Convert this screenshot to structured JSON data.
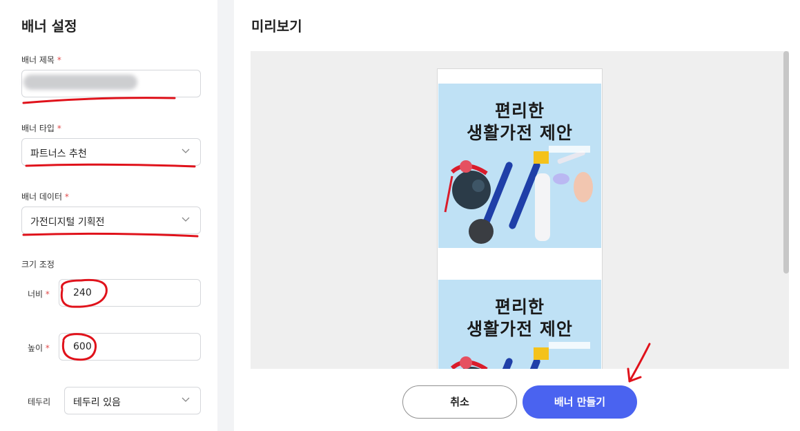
{
  "settings": {
    "heading": "배너 설정",
    "required_mark": "*",
    "title_label": "배너 제목",
    "type_label": "배너 타입",
    "type_value": "파트너스 추천",
    "data_label": "배너 데이터",
    "data_value": "가전디지털 기획전",
    "size_label": "크기 조정",
    "width_label": "너비",
    "width_value": "240",
    "height_label": "높이",
    "height_value": "600",
    "border_label": "테두리",
    "border_value": "테두리 있음"
  },
  "preview": {
    "heading": "미리보기",
    "banner_line1": "편리한",
    "banner_line2": "생활가전 제안"
  },
  "actions": {
    "cancel_label": "취소",
    "create_label": "배너 만들기"
  },
  "colors": {
    "primary_button": "#4a63f0",
    "banner_background": "#bfe1f5",
    "annotation": "#e0121b"
  }
}
